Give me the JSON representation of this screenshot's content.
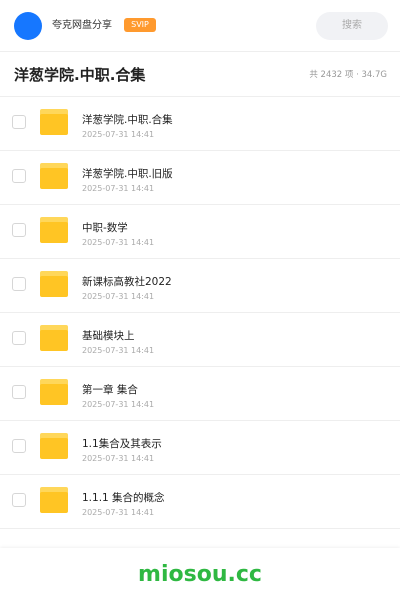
{
  "header": {
    "share_name": "夸克网盘分享",
    "badge": "SVIP",
    "search_label": "搜索"
  },
  "folder": {
    "title": "洋葱学院.中职.合集",
    "summary": "共 2432 项 · 34.7G"
  },
  "items": [
    {
      "name": "洋葱学院.中职.合集",
      "date": "2025-07-31 14:41"
    },
    {
      "name": "洋葱学院.中职.旧版",
      "date": "2025-07-31 14:41"
    },
    {
      "name": "中职-数学",
      "date": "2025-07-31 14:41"
    },
    {
      "name": "新课标高教社2022",
      "date": "2025-07-31 14:41"
    },
    {
      "name": "基础模块上",
      "date": "2025-07-31 14:41"
    },
    {
      "name": "第一章 集合",
      "date": "2025-07-31 14:41"
    },
    {
      "name": "1.1集合及其表示",
      "date": "2025-07-31 14:41"
    },
    {
      "name": "1.1.1 集合的概念",
      "date": "2025-07-31 14:41"
    }
  ],
  "watermark": "miosou.cc",
  "colors": {
    "avatar": "#1677ff",
    "badge": "#ff9a2e",
    "folder": "#ffc524",
    "watermark": "#2fb842"
  },
  "icons": {
    "folder": "folder-icon",
    "checkbox": "checkbox-icon"
  }
}
